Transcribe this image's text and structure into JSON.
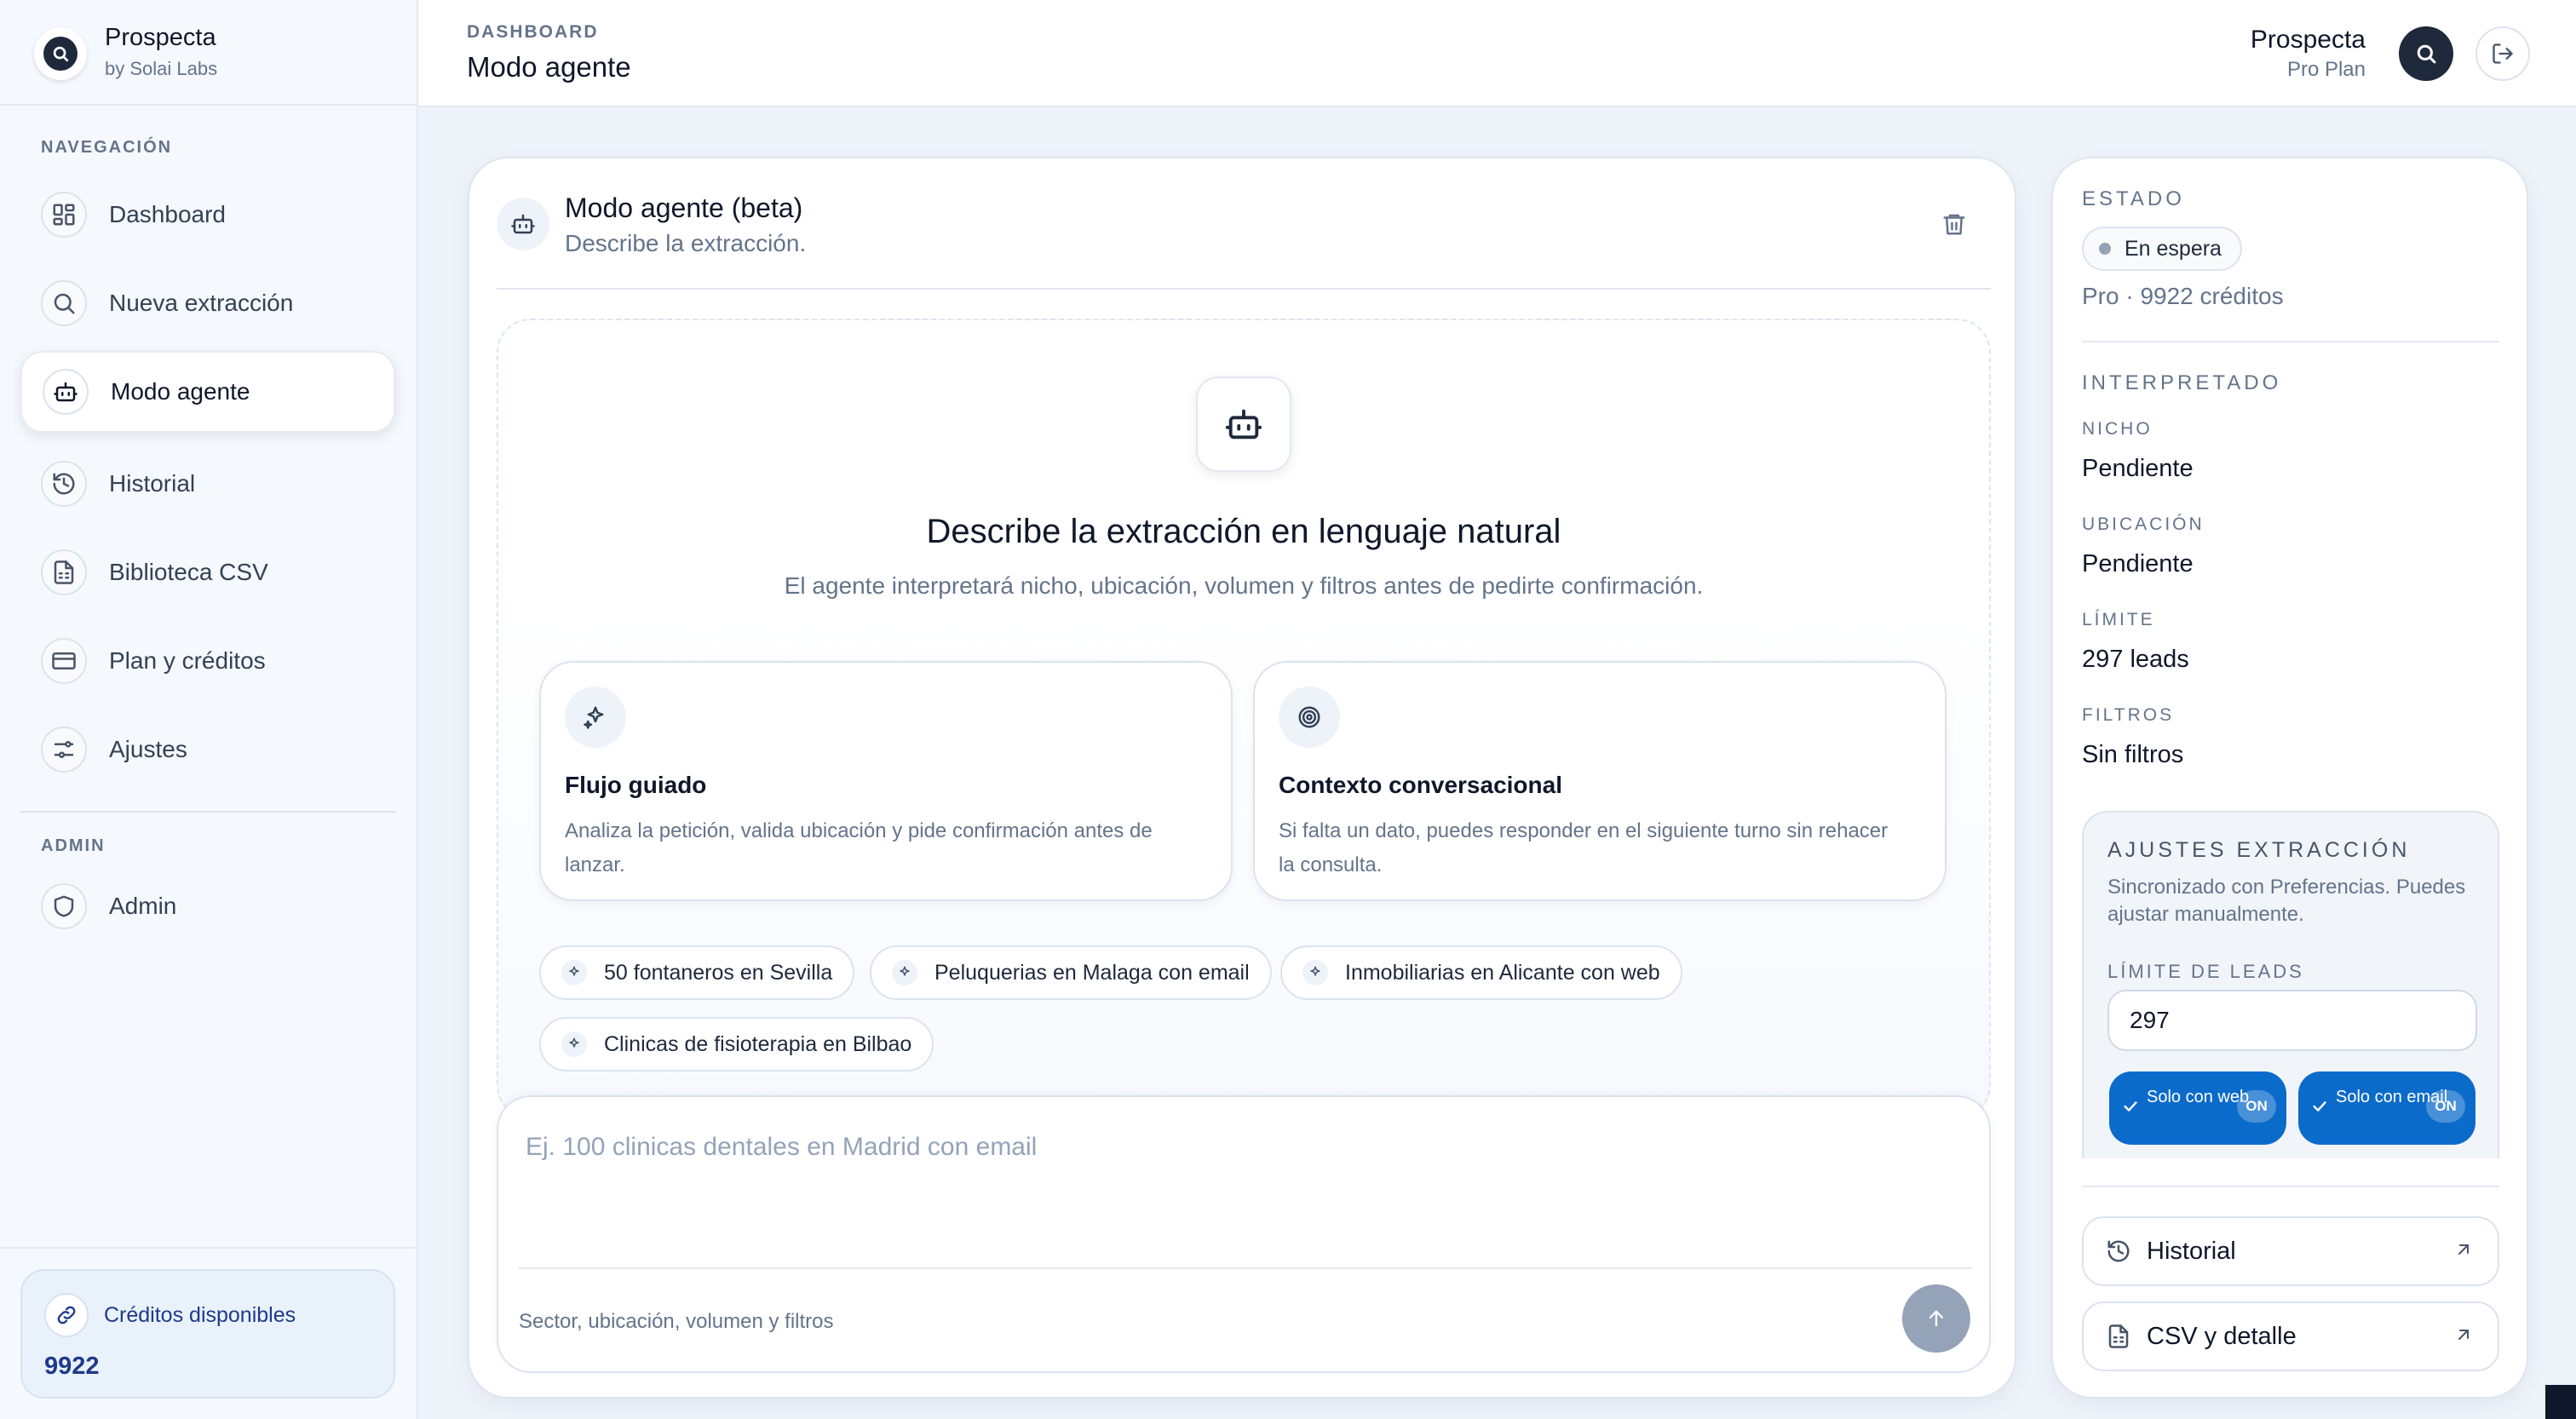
{
  "brand": {
    "name": "Prospecta",
    "sub": "by Solai Labs"
  },
  "sidebar": {
    "nav_label": "NAVEGACIÓN",
    "items": [
      {
        "label": "Dashboard",
        "icon": "dashboard-icon"
      },
      {
        "label": "Nueva extracción",
        "icon": "search-icon"
      },
      {
        "label": "Modo agente",
        "icon": "robot-icon",
        "active": true
      },
      {
        "label": "Historial",
        "icon": "history-icon"
      },
      {
        "label": "Biblioteca CSV",
        "icon": "file-icon"
      },
      {
        "label": "Plan y créditos",
        "icon": "credit-card-icon"
      },
      {
        "label": "Ajustes",
        "icon": "sliders-icon"
      }
    ],
    "admin_label": "ADMIN",
    "admin_item": {
      "label": "Admin",
      "icon": "shield-icon"
    },
    "credits": {
      "label": "Créditos disponibles",
      "value": "9922"
    }
  },
  "topbar": {
    "breadcrumb": "DASHBOARD",
    "title": "Modo agente",
    "user_name": "Prospecta",
    "user_plan": "Pro Plan"
  },
  "agent": {
    "title": "Modo agente (beta)",
    "subtitle": "Describe la extracción.",
    "hero_title": "Describe la extracción en lenguaje natural",
    "hero_sub": "El agente interpretará nicho, ubicación, volumen y filtros antes de pedirte confirmación.",
    "features": [
      {
        "title": "Flujo guiado",
        "desc": "Analiza la petición, valida ubicación y pide confirmación antes de lanzar.",
        "icon": "sparkles-icon"
      },
      {
        "title": "Contexto conversacional",
        "desc": "Si falta un dato, puedes responder en el siguiente turno sin rehacer la consulta.",
        "icon": "target-icon"
      }
    ],
    "suggestions": [
      "50 fontaneros en Sevilla",
      "Peluquerias en Malaga con email",
      "Inmobiliarias en Alicante con web",
      "Clinicas de fisioterapia en Bilbao"
    ],
    "composer": {
      "placeholder": "Ej. 100 clinicas dentales en Madrid con email",
      "hint": "Sector, ubicación, volumen y filtros"
    }
  },
  "panel": {
    "status_label": "ESTADO",
    "status": "En espera",
    "plan_credits": "Pro · 9922 créditos",
    "interpreted_label": "INTERPRETADO",
    "fields": [
      {
        "label": "NICHO",
        "value": "Pendiente"
      },
      {
        "label": "UBICACIÓN",
        "value": "Pendiente"
      },
      {
        "label": "LÍMITE",
        "value": "297 leads"
      },
      {
        "label": "FILTROS",
        "value": "Sin filtros"
      }
    ],
    "settings": {
      "label": "AJUSTES EXTRACCIÓN",
      "desc": "Sincronizado con Preferencias. Puedes ajustar manualmente.",
      "limit_label": "LÍMITE DE LEADS",
      "limit_value": "297",
      "toggles": [
        {
          "label": "Solo con web",
          "state": "ON"
        },
        {
          "label": "Solo con email",
          "state": "ON"
        }
      ]
    },
    "links": [
      {
        "label": "Historial",
        "icon": "history-icon"
      },
      {
        "label": "CSV y detalle",
        "icon": "file-icon"
      }
    ]
  },
  "colors": {
    "accent": "#0b6bcb",
    "dark": "#1e293b",
    "muted": "#64748b"
  }
}
